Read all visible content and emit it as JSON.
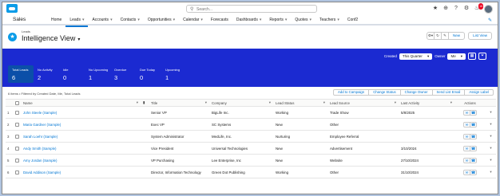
{
  "header": {
    "search_placeholder": "Search...",
    "notification_count": "15"
  },
  "nav": {
    "app_name": "Sales",
    "items": [
      {
        "label": "Home",
        "chevron": false,
        "active": false
      },
      {
        "label": "Leads",
        "chevron": true,
        "active": true
      },
      {
        "label": "Accounts",
        "chevron": true,
        "active": false
      },
      {
        "label": "Contacts",
        "chevron": true,
        "active": false
      },
      {
        "label": "Opportunities",
        "chevron": true,
        "active": false
      },
      {
        "label": "Calendar",
        "chevron": true,
        "active": false
      },
      {
        "label": "Forecasts",
        "chevron": false,
        "active": false
      },
      {
        "label": "Dashboards",
        "chevron": true,
        "active": false
      },
      {
        "label": "Reports",
        "chevron": true,
        "active": false
      },
      {
        "label": "Quotes",
        "chevron": true,
        "active": false
      },
      {
        "label": "Teachers",
        "chevron": true,
        "active": false
      },
      {
        "label": "Conf2",
        "chevron": false,
        "active": false
      }
    ]
  },
  "list_header": {
    "object_label": "Leads",
    "title": "Intelligence View",
    "new_label": "New",
    "list_view_label": "List View"
  },
  "intelligence": {
    "created_label": "Created",
    "created_value": "This Quarter",
    "owner_label": "Owner",
    "owner_value": "Me",
    "metrics": [
      {
        "label": "Total Leads",
        "value": "6",
        "selected": true
      },
      {
        "label": "No Activity",
        "value": "2",
        "selected": false
      },
      {
        "label": "Idle",
        "value": "0",
        "selected": false
      },
      {
        "label": "No Upcoming",
        "value": "1",
        "selected": false
      },
      {
        "label": "Overdue",
        "value": "3",
        "selected": false
      },
      {
        "label": "Due Today",
        "value": "0",
        "selected": false
      },
      {
        "label": "Upcoming",
        "value": "1",
        "selected": false
      }
    ]
  },
  "toolbar": {
    "info": "6 items • Filtered by Created Date, Me, Total Leads",
    "buttons": [
      "Add to Campaign",
      "Change Status",
      "Change Owner",
      "Send List Email",
      "Assign Label"
    ]
  },
  "table": {
    "columns": {
      "name": "Name",
      "title": "Title",
      "company": "Company",
      "lead_status": "Lead Status",
      "lead_source": "Lead Source",
      "last_activity": "Last Activity",
      "actions": "Actions"
    },
    "rows": [
      {
        "num": "1",
        "name": "John Steele (Sample)",
        "title": "Senior VP",
        "company": "BigLife Inc.",
        "status": "Working",
        "source": "Trade Show",
        "activity": "5/8/2025"
      },
      {
        "num": "2",
        "name": "Maria Gardner (Sample)",
        "title": "Exec VP",
        "company": "SC Systems",
        "status": "New",
        "source": "Other",
        "activity": ""
      },
      {
        "num": "3",
        "name": "Sarah Loehr (Sample)",
        "title": "System Administrator",
        "company": "MedLife, Inc.",
        "status": "Nurturing",
        "source": "Employee Referral",
        "activity": ""
      },
      {
        "num": "4",
        "name": "Andy Smith (Sample)",
        "title": "Vice President",
        "company": "Universal Technologies",
        "status": "New",
        "source": "Advertisement",
        "activity": "3/10/2024"
      },
      {
        "num": "5",
        "name": "Amy Jordan (Sample)",
        "title": "VP Purchasing",
        "company": "Lee Enterprise, Inc",
        "status": "New",
        "source": "Website",
        "activity": "27/10/2024"
      },
      {
        "num": "6",
        "name": "David Addison (Sample)",
        "title": "Director, Information Technology",
        "company": "Green Dot Publishing",
        "status": "Working",
        "source": "Other",
        "activity": "31/10/2024"
      }
    ]
  },
  "icons": {
    "email": "envelope-icon",
    "call": "phone-icon"
  }
}
